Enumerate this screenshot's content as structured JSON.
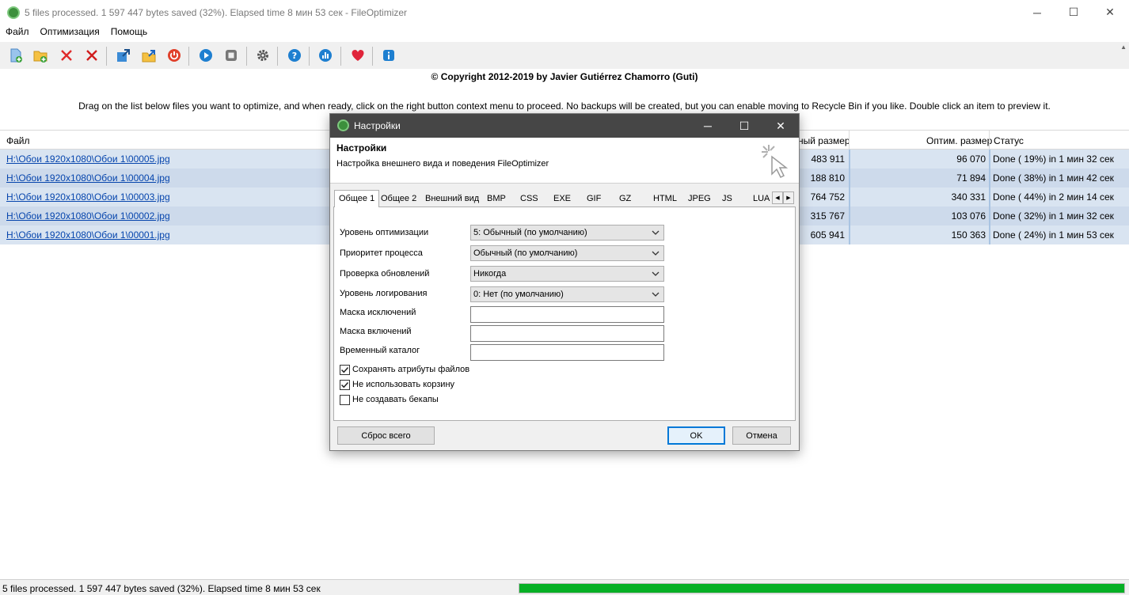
{
  "window": {
    "title": "5 files processed. 1 597 447 bytes saved (32%). Elapsed time  8 мин 53 сек - FileOptimizer",
    "minimize": "─",
    "maximize": "☐",
    "close": "✕"
  },
  "menu": [
    "Файл",
    "Оптимизация",
    "Помощь"
  ],
  "toolbar": {
    "buttons": [
      "add-files",
      "add-folder",
      "remove",
      "clear",
      "optimize",
      "open-folder",
      "power",
      "play",
      "stop",
      "settings",
      "help",
      "stats",
      "donate",
      "info"
    ],
    "scroll_glyph": "▲"
  },
  "copyright": "© Copyright 2012-2019 by Javier Gutiérrez Chamorro (Guti)",
  "hint": "Drag on the list below files you want to optimize, and when ready, click on the right button context menu to proceed. No backups will be created, but you can enable moving to Recycle Bin if you like. Double click an item to preview it.",
  "table": {
    "columns": {
      "file": "Файл",
      "orig": "ный размер",
      "opt": "Оптим. размер",
      "status": "Статус"
    },
    "rows": [
      {
        "file": "H:\\Обои 1920x1080\\Обои 1\\00005.jpg",
        "orig": "483 911",
        "opt": "96 070",
        "status": "Done ( 19%) in  1 мин 32 сек"
      },
      {
        "file": "H:\\Обои 1920x1080\\Обои 1\\00004.jpg",
        "orig": "188 810",
        "opt": "71 894",
        "status": "Done ( 38%) in  1 мин 42 сек"
      },
      {
        "file": "H:\\Обои 1920x1080\\Обои 1\\00003.jpg",
        "orig": "764 752",
        "opt": "340 331",
        "status": "Done ( 44%) in  2 мин 14 сек"
      },
      {
        "file": "H:\\Обои 1920x1080\\Обои 1\\00002.jpg",
        "orig": "315 767",
        "opt": "103 076",
        "status": "Done ( 32%) in  1 мин 32 сек"
      },
      {
        "file": "H:\\Обои 1920x1080\\Обои 1\\00001.jpg",
        "orig": "605 941",
        "opt": "150 363",
        "status": "Done ( 24%) in  1 мин 53 сек"
      }
    ]
  },
  "statusbar": {
    "text": "5 files processed. 1 597 447 bytes saved (32%). Elapsed time  8 мин 53 сек",
    "progress": 100,
    "progress_color": "#06b025"
  },
  "dialog": {
    "title": "Настройки",
    "header_title": "Настройки",
    "header_subtitle": "Настройка внешнего вида и поведения FileOptimizer",
    "tabs": [
      "Общее 1",
      "Общее 2",
      "Внешний вид",
      "BMP",
      "CSS",
      "EXE",
      "GIF",
      "GZ",
      "HTML",
      "JPEG",
      "JS",
      "LUA"
    ],
    "active_tab": "Общее 1",
    "tab_scroll": [
      "◀",
      "▶"
    ],
    "fields": {
      "opt_level": {
        "label": "Уровень оптимизации",
        "value": "5: Обычный (по умолчанию)"
      },
      "priority": {
        "label": "Приоритет процесса",
        "value": "Обычный (по умолчанию)"
      },
      "updates": {
        "label": "Проверка обновлений",
        "value": "Никогда"
      },
      "log_level": {
        "label": "Уровень логирования",
        "value": "0: Нет (по умолчанию)"
      },
      "exclude_mask": {
        "label": "Маска исключений",
        "value": ""
      },
      "include_mask": {
        "label": "Маска включений",
        "value": ""
      },
      "temp_dir": {
        "label": "Временный каталог",
        "value": ""
      }
    },
    "checkboxes": [
      {
        "label": "Сохранять атрибуты файлов",
        "checked": true
      },
      {
        "label": "Не использовать корзину",
        "checked": true
      },
      {
        "label": "Не создавать бекапы",
        "checked": false
      }
    ],
    "buttons": {
      "reset": "Сброс всего",
      "ok": "OK",
      "cancel": "Отмена"
    },
    "accent": "#0078d7"
  }
}
